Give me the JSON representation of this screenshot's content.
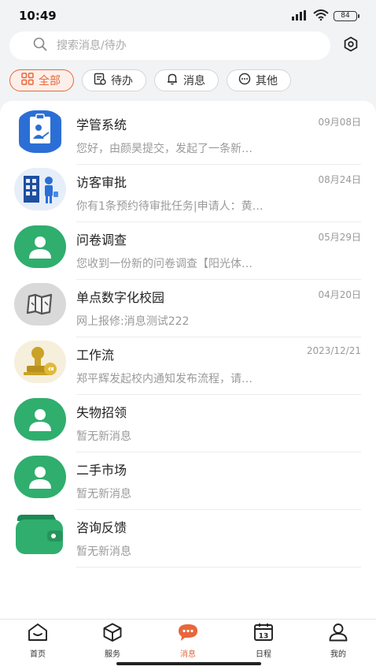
{
  "status": {
    "time": "10:49",
    "battery": "84"
  },
  "search": {
    "placeholder": "搜索消息/待办"
  },
  "filters": [
    {
      "label": "全部",
      "icon": "grid-icon"
    },
    {
      "label": "待办",
      "icon": "todo-icon"
    },
    {
      "label": "消息",
      "icon": "bell-icon"
    },
    {
      "label": "其他",
      "icon": "more-icon"
    }
  ],
  "messages": [
    {
      "title": "学管系统",
      "date": "09月08日",
      "preview": "您好，由颜昊提交，发起了一条新…",
      "icon": "student-management-icon"
    },
    {
      "title": "访客审批",
      "date": "08月24日",
      "preview": "你有1条预约待审批任务|申请人：黄…",
      "icon": "visitor-icon"
    },
    {
      "title": "问卷调查",
      "date": "05月29日",
      "preview": "您收到一份新的问卷调查【阳光体…",
      "icon": "user-icon"
    },
    {
      "title": "单点数字化校园",
      "date": "04月20日",
      "preview": "网上报修:消息测试222",
      "icon": "map-icon"
    },
    {
      "title": "工作流",
      "date": "2023/12/21",
      "preview": "郑平辉发起校内通知发布流程，请…",
      "icon": "stamp-icon"
    },
    {
      "title": "失物招领",
      "date": "",
      "preview": "暂无新消息",
      "icon": "user-icon"
    },
    {
      "title": "二手市场",
      "date": "",
      "preview": "暂无新消息",
      "icon": "user-icon"
    },
    {
      "title": "咨询反馈",
      "date": "",
      "preview": "暂无新消息",
      "icon": "wallet-icon"
    }
  ],
  "tabs": [
    {
      "label": "首页",
      "icon": "home-icon"
    },
    {
      "label": "服务",
      "icon": "cube-icon"
    },
    {
      "label": "消息",
      "icon": "chat-icon"
    },
    {
      "label": "日程",
      "icon": "calendar-icon"
    },
    {
      "label": "我的",
      "icon": "profile-icon"
    }
  ],
  "colors": {
    "accent": "#e8673b",
    "green": "#2fae6e",
    "blue": "#2b6fd6"
  }
}
